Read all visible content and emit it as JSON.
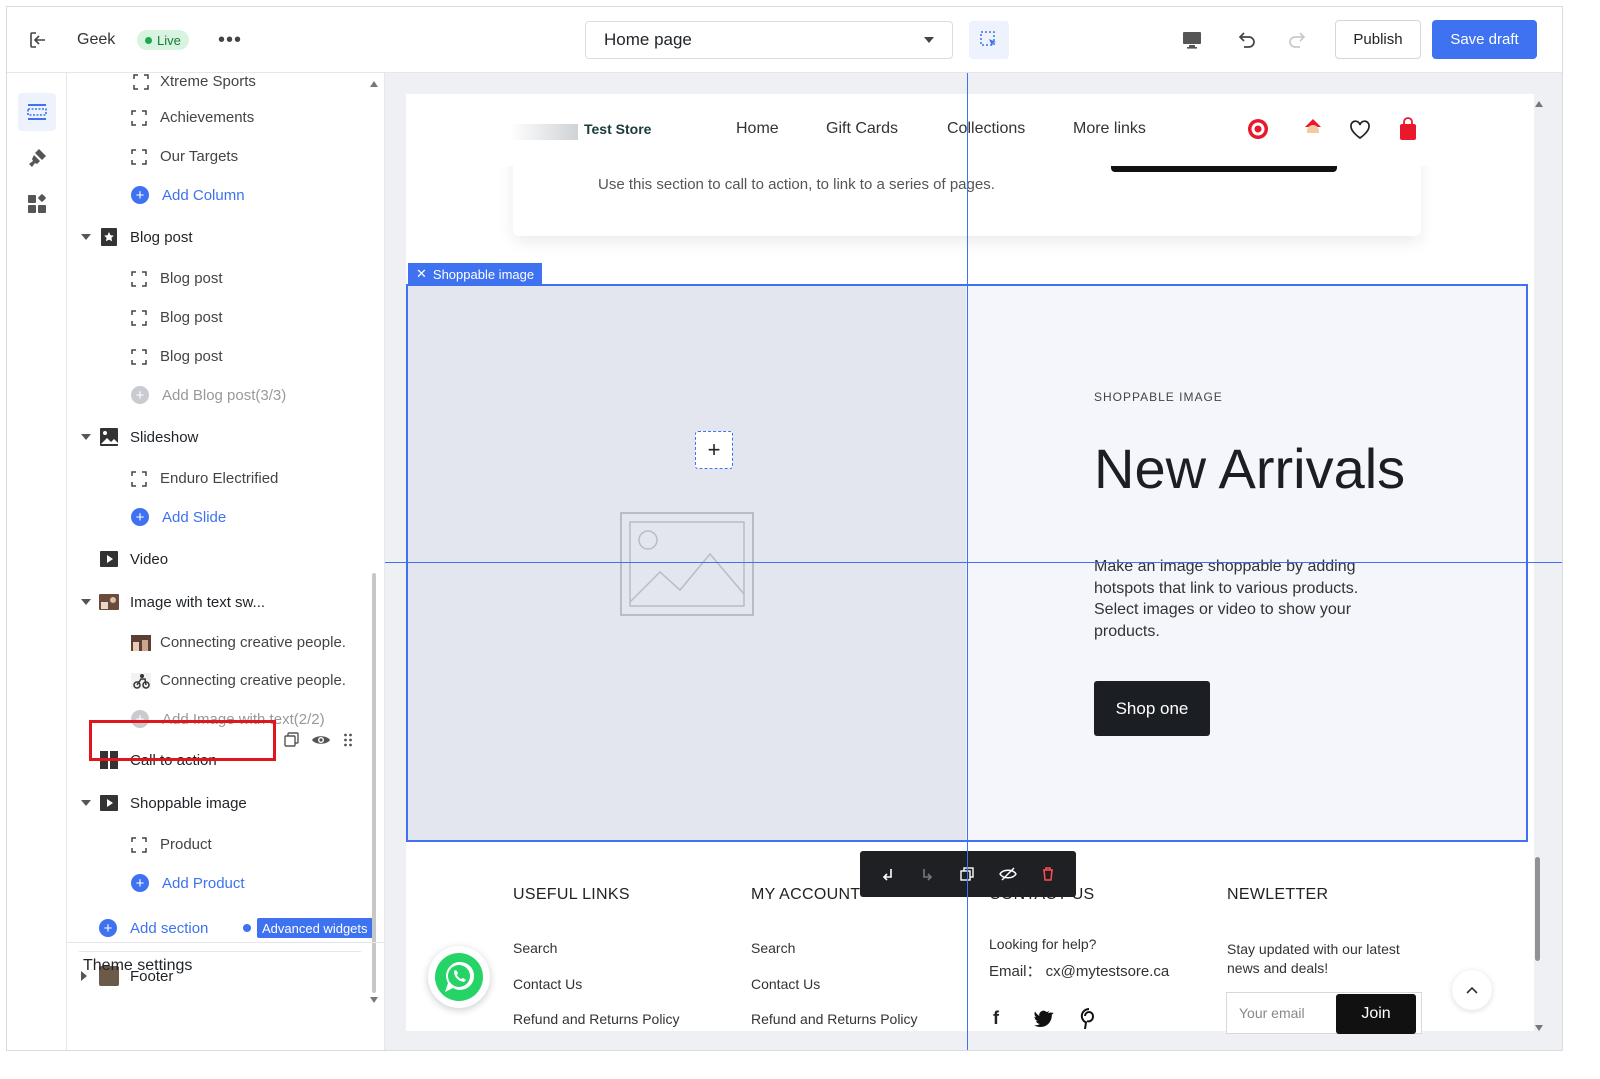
{
  "topbar": {
    "store_name": "Geek",
    "live_label": "Live",
    "page_select": "Home page",
    "publish_label": "Publish",
    "save_draft_label": "Save draft"
  },
  "sidebar": {
    "partial_top": "Xtreme Sports",
    "items": [
      {
        "kind": "child",
        "label": "Achievements"
      },
      {
        "kind": "child",
        "label": "Our Targets"
      },
      {
        "kind": "add",
        "label": "Add Column"
      },
      {
        "kind": "section",
        "label": "Blog post"
      },
      {
        "kind": "child",
        "label": "Blog post"
      },
      {
        "kind": "child",
        "label": "Blog post"
      },
      {
        "kind": "child",
        "label": "Blog post"
      },
      {
        "kind": "add-disabled",
        "label": "Add Blog post(3/3)"
      },
      {
        "kind": "section",
        "label": "Slideshow"
      },
      {
        "kind": "child",
        "label": "Enduro Electrified"
      },
      {
        "kind": "add",
        "label": "Add Slide"
      },
      {
        "kind": "section",
        "label": "Video"
      },
      {
        "kind": "section",
        "label": "Image with text sw..."
      },
      {
        "kind": "child",
        "label": "Connecting creative people."
      },
      {
        "kind": "child",
        "label": "Connecting creative people."
      },
      {
        "kind": "add-disabled",
        "label": "Add Image with text(2/2)"
      },
      {
        "kind": "section",
        "label": "Call to action"
      },
      {
        "kind": "section",
        "label": "Shoppable image"
      },
      {
        "kind": "child",
        "label": "Product"
      },
      {
        "kind": "add",
        "label": "Add Product"
      }
    ],
    "add_section_label": "Add section",
    "advanced_widgets_label": "Advanced widgets",
    "footer_label": "Footer",
    "theme_settings_label": "Theme settings"
  },
  "preview": {
    "logo_text": "Test Store",
    "nav_links": [
      "Home",
      "Gift Cards",
      "Collections",
      "More links"
    ],
    "cta_text": "Use this section to call to action, to link to a series of pages.",
    "shoppable": {
      "tag_label": "Shoppable image",
      "eyebrow": "SHOPPABLE IMAGE",
      "heading": "New Arrivals",
      "body": "Make an image shoppable by adding hotspots that link to various products. Select images or video to show your products.",
      "button_label": "Shop one"
    },
    "footer": {
      "col1_title": "USEFUL LINKS",
      "col1_links": [
        "Search",
        "Contact Us",
        "Refund and Returns Policy"
      ],
      "col2_title": "MY ACCOUNT",
      "col2_links": [
        "Search",
        "Contact Us",
        "Refund and Returns Policy"
      ],
      "col3_title": "CONTACT US",
      "col3_help": "Looking for help?",
      "col3_email": "Email： cx@mytestsore.ca",
      "col4_title": "NEWLETTER",
      "col4_text": "Stay updated with our latest news and deals!",
      "email_placeholder": "Your email",
      "join_label": "Join"
    }
  },
  "colors": {
    "accent": "#3e72f0",
    "highlight": "#e0161e",
    "live": "#1ea94a"
  }
}
